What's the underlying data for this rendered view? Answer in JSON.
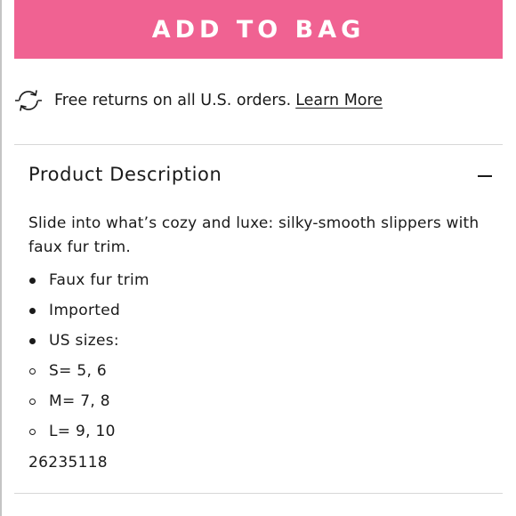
{
  "add_to_bag": {
    "label": "ADD TO BAG",
    "color": "#f06292"
  },
  "returns": {
    "icon": "refresh-arrows-icon",
    "text": "Free returns on all U.S. orders.",
    "link": "Learn More"
  },
  "description": {
    "title": "Product Description",
    "toggle_icon": "minus-icon",
    "expanded": true,
    "text": "Slide into what’s cozy and luxe: silky-smooth slippers with faux fur trim.",
    "bullets": [
      "Faux fur trim",
      "Imported",
      "US sizes:"
    ],
    "sub_bullets": [
      "S= 5, 6",
      "M= 7, 8",
      "L= 9, 10"
    ],
    "sku": "26235118"
  }
}
